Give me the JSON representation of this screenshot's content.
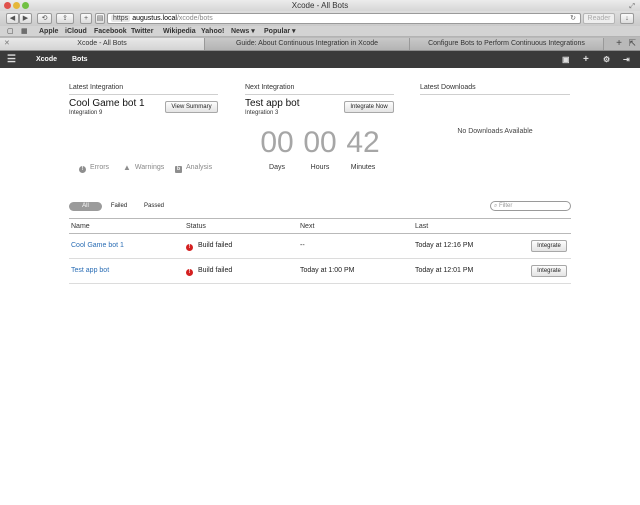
{
  "window": {
    "title": "Xcode - All Bots"
  },
  "toolbar": {
    "back_icon": "back-arrow-icon",
    "forward_icon": "forward-arrow-icon",
    "url_scheme": "https",
    "url_host": "augustus.local",
    "url_path": "/xcode/bots",
    "reader_label": "Reader"
  },
  "bookmarks": [
    "Apple",
    "iCloud",
    "Facebook",
    "Twitter",
    "Wikipedia",
    "Yahoo!",
    "News ▾",
    "Popular ▾"
  ],
  "tabs": [
    {
      "label": "Xcode - All Bots",
      "active": true
    },
    {
      "label": "Guide: About Continuous Integration in Xcode",
      "active": false
    },
    {
      "label": "Configure Bots to Perform Continuous Integrations",
      "active": false
    }
  ],
  "appnav": {
    "brand": "Xcode",
    "bots": "Bots"
  },
  "latest": {
    "title": "Latest Integration",
    "bot": "Cool Game bot 1",
    "integration": "Integration 9",
    "button": "View Summary",
    "errors": "Errors",
    "warnings": "Warnings",
    "analysis": "Analysis"
  },
  "next": {
    "title": "Next Integration",
    "bot": "Test app bot",
    "integration": "Integration 3",
    "button": "Integrate Now",
    "days": "00",
    "hours": "00",
    "minutes": "42",
    "days_label": "Days",
    "hours_label": "Hours",
    "minutes_label": "Minutes"
  },
  "downloads": {
    "title": "Latest Downloads",
    "empty": "No Downloads Available"
  },
  "filters": {
    "all": "All",
    "failed": "Failed",
    "passed": "Passed",
    "search_placeholder": "Filter"
  },
  "table": {
    "headers": [
      "Name",
      "Status",
      "Next",
      "Last"
    ],
    "rows": [
      {
        "name": "Cool Game bot 1",
        "status": "Build failed",
        "next": "--",
        "last": "Today at 12:16 PM",
        "action": "Integrate"
      },
      {
        "name": "Test app bot",
        "status": "Build failed",
        "next": "Today at 1:00 PM",
        "last": "Today at 12:01 PM",
        "action": "Integrate"
      }
    ]
  },
  "colors": {
    "link": "#2a6db5",
    "error": "#d42020",
    "nav_bg": "#3a3a3a",
    "countdown": "#a6a6a6"
  }
}
